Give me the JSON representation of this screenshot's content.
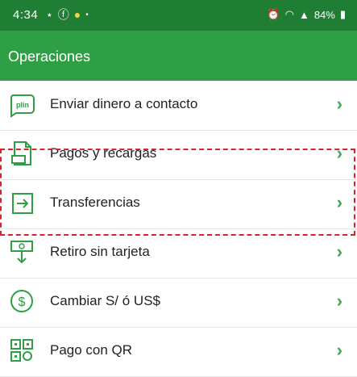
{
  "status_bar": {
    "time": "4:34",
    "left_icons": [
      "weather-icon",
      "facebook-icon",
      "notification-dot-icon",
      "dot-icon"
    ],
    "right_icons": [
      "alarm-icon",
      "wifi-icon",
      "signal-icon"
    ],
    "battery": "84%"
  },
  "header": {
    "title": "Operaciones"
  },
  "menu": {
    "items": [
      {
        "label": "Enviar dinero a contacto",
        "icon": "plin-icon"
      },
      {
        "label": "Pagos y recargas",
        "icon": "document-icon"
      },
      {
        "label": "Transferencias",
        "icon": "transfer-icon"
      },
      {
        "label": "Retiro sin tarjeta",
        "icon": "cash-withdraw-icon"
      },
      {
        "label": "Cambiar S/ ó US$",
        "icon": "exchange-icon"
      },
      {
        "label": "Pago con QR",
        "icon": "qr-icon"
      }
    ],
    "chevron": "›"
  },
  "colors": {
    "status_bar": "#1f7d34",
    "app_bar": "#2f9f45",
    "accent": "#3aa94b",
    "highlight": "#d9232d"
  }
}
